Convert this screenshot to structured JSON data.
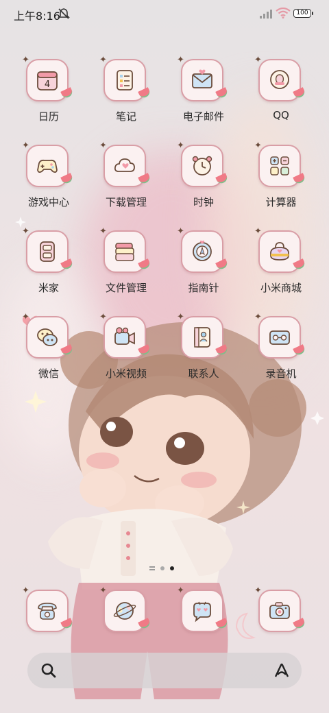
{
  "status_bar": {
    "time": "上午8:16",
    "battery": "100"
  },
  "apps": [
    {
      "label": "日历",
      "icon": "calendar-icon",
      "day": "4"
    },
    {
      "label": "笔记",
      "icon": "notes-icon"
    },
    {
      "label": "电子邮件",
      "icon": "mail-icon"
    },
    {
      "label": "QQ",
      "icon": "qq-icon"
    },
    {
      "label": "游戏中心",
      "icon": "gamepad-icon"
    },
    {
      "label": "下载管理",
      "icon": "cloud-download-icon"
    },
    {
      "label": "时钟",
      "icon": "alarm-clock-icon"
    },
    {
      "label": "计算器",
      "icon": "calculator-icon"
    },
    {
      "label": "米家",
      "icon": "smart-home-icon"
    },
    {
      "label": "文件管理",
      "icon": "folder-icon"
    },
    {
      "label": "指南针",
      "icon": "compass-icon"
    },
    {
      "label": "小米商城",
      "icon": "shopping-bag-icon"
    },
    {
      "label": "微信",
      "icon": "wechat-icon"
    },
    {
      "label": "小米视频",
      "icon": "video-camera-icon"
    },
    {
      "label": "联系人",
      "icon": "contacts-icon"
    },
    {
      "label": "录音机",
      "icon": "recorder-icon"
    }
  ],
  "dock": [
    {
      "icon": "phone-icon"
    },
    {
      "icon": "browser-globe-icon"
    },
    {
      "icon": "message-bubble-icon"
    },
    {
      "icon": "camera-icon"
    }
  ],
  "page_indicator": {
    "pages": 2,
    "active": 2
  },
  "colors": {
    "tile_bg": "#fbf1f1",
    "tile_border": "#d99ea6",
    "accent_pink": "#f07a86"
  }
}
